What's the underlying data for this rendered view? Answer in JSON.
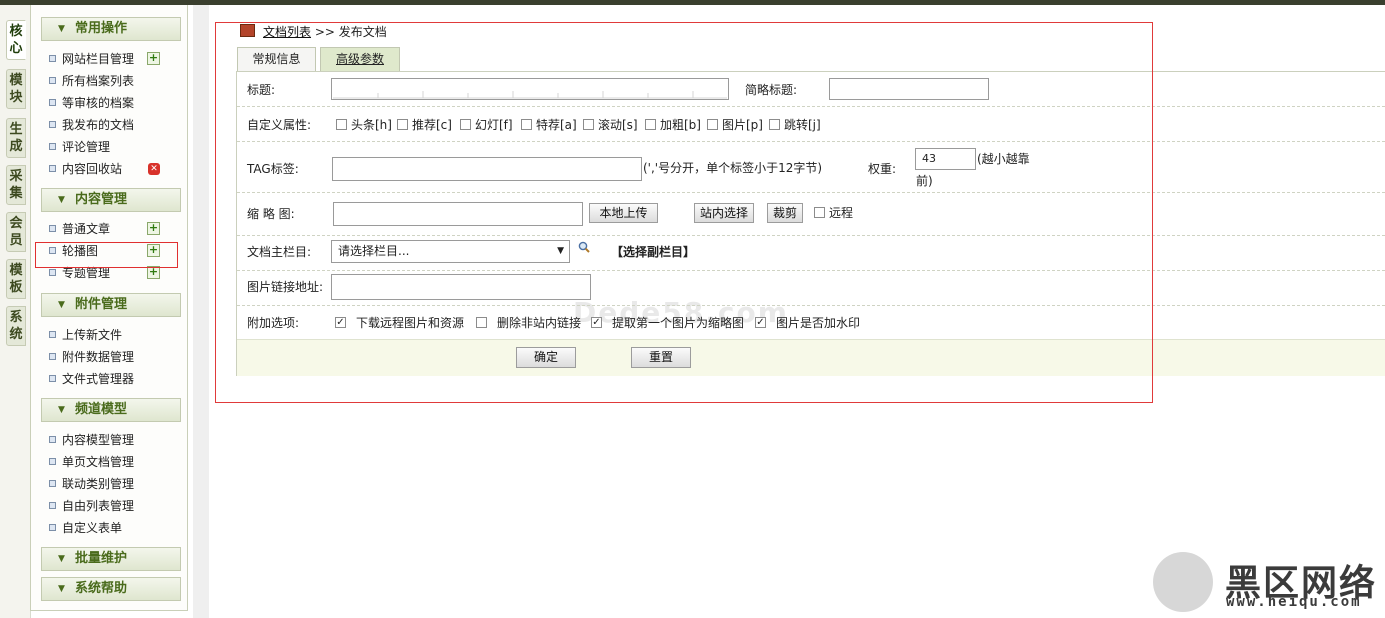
{
  "vtabs": [
    "核心",
    "模块",
    "生成",
    "采集",
    "会员",
    "模板",
    "系统"
  ],
  "sidebar": {
    "groups": [
      {
        "title": "常用操作",
        "items": [
          "网站栏目管理",
          "所有档案列表",
          "等审核的档案",
          "我发布的文档",
          "评论管理",
          "内容回收站"
        ]
      },
      {
        "title": "内容管理",
        "items": [
          "普通文章",
          "轮播图",
          "专题管理"
        ]
      },
      {
        "title": "附件管理",
        "items": [
          "上传新文件",
          "附件数据管理",
          "文件式管理器"
        ]
      },
      {
        "title": "频道模型",
        "items": [
          "内容模型管理",
          "单页文档管理",
          "联动类别管理",
          "自由列表管理",
          "自定义表单"
        ]
      },
      {
        "title": "批量维护",
        "items": []
      },
      {
        "title": "系统帮助",
        "items": []
      }
    ]
  },
  "breadcrumb": {
    "link": "文档列表",
    "sep": ">>",
    "current": "发布文档"
  },
  "tabs": [
    "常规信息",
    "高级参数"
  ],
  "form": {
    "title_label": "标题:",
    "short_title_label": "简略标题:",
    "attr_label": "自定义属性:",
    "attrs": [
      "头条[h]",
      "推荐[c]",
      "幻灯[f]",
      "特荐[a]",
      "滚动[s]",
      "加粗[b]",
      "图片[p]",
      "跳转[j]"
    ],
    "tag_label": "TAG标签:",
    "tag_hint": "(','号分开，单个标签小于12字节)",
    "weight_label": "权重:",
    "weight_value": "43",
    "weight_hint_1": "(越小越靠",
    "weight_hint_2": "前)",
    "thumb_label": "缩 略 图:",
    "upload_btn": "本地上传",
    "site_select_btn": "站内选择",
    "crop_btn": "裁剪",
    "remote_label": "远程",
    "category_label": "文档主栏目:",
    "category_value": "请选择栏目...",
    "sub_category_link": "【选择副栏目】",
    "img_link_label": "图片链接地址:",
    "extra_label": "附加选项:",
    "extras": [
      {
        "label": "下载远程图片和资源",
        "checked": true
      },
      {
        "label": "删除非站内链接",
        "checked": false
      },
      {
        "label": "提取第一个图片为缩略图",
        "checked": true
      },
      {
        "label": "图片是否加水印",
        "checked": true
      }
    ],
    "ok_btn": "确定",
    "reset_btn": "重置"
  },
  "watermark": {
    "dede": "Dede58.com",
    "brand_cn": "黑区网络",
    "brand_url": "www.heiqu.com"
  }
}
